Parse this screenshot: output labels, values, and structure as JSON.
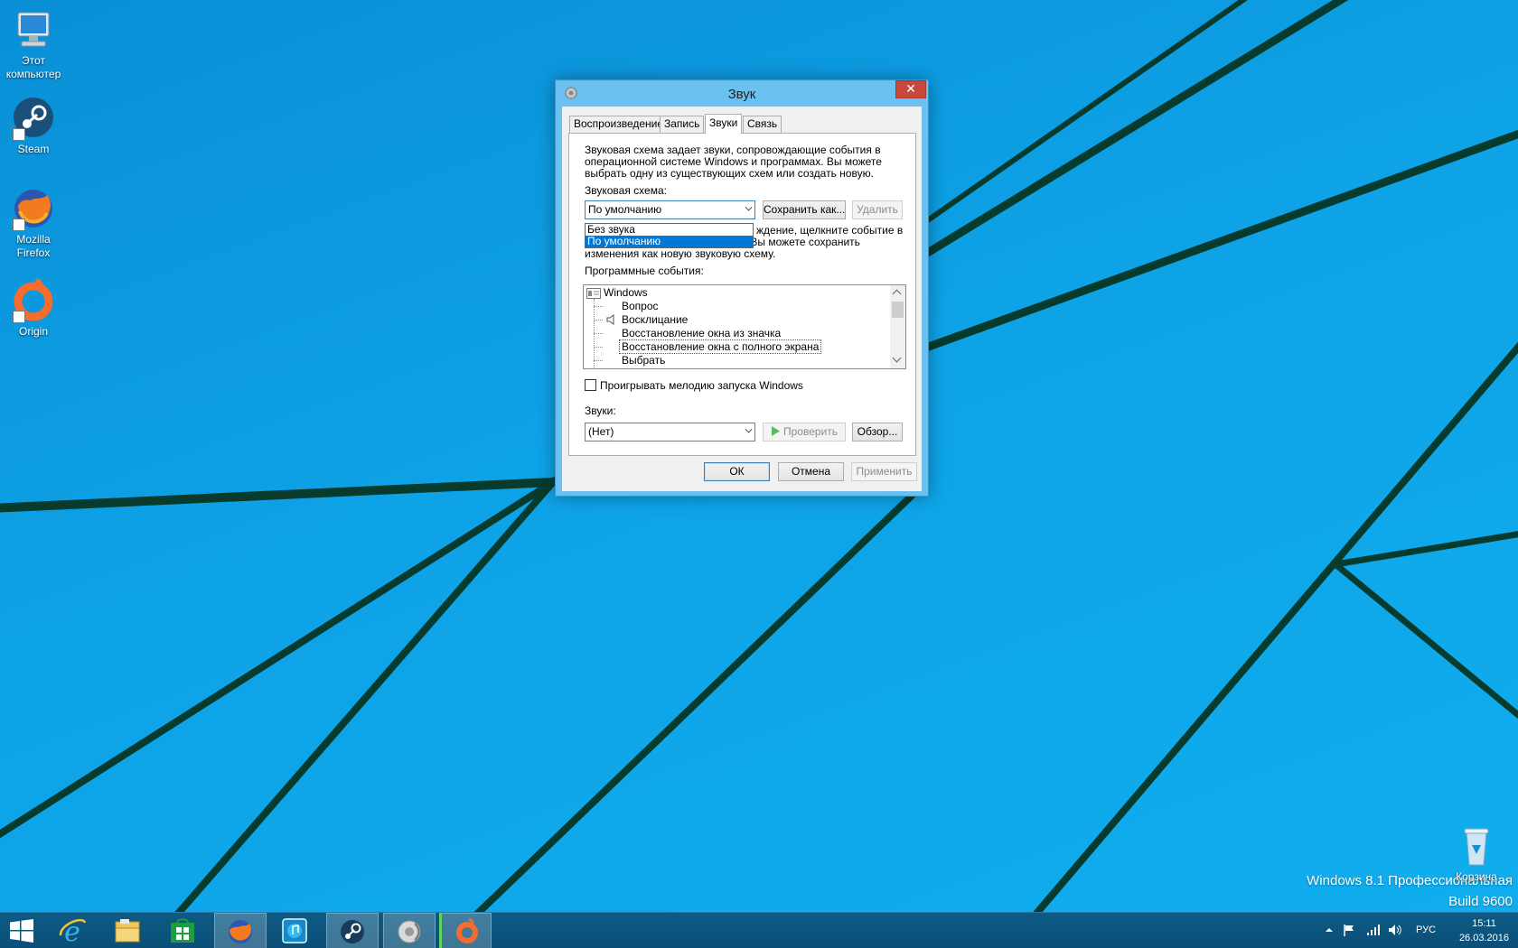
{
  "colors": {
    "desktop_blue": "#10aeee",
    "wallpaper_lines": "#063b2e",
    "dialog_frame": "#6ac1f1",
    "close_button": "#c7483b",
    "selection": "#0078d7",
    "taskbar": "#0b4f77"
  },
  "desktop_icons": [
    {
      "label": "Этот компьютер",
      "icon": "computer-icon"
    },
    {
      "label": "Steam",
      "icon": "steam-icon"
    },
    {
      "label": "Mozilla Firefox",
      "icon": "firefox-icon"
    },
    {
      "label": "Origin",
      "icon": "origin-icon"
    },
    {
      "label": "Корзина",
      "icon": "recycle-bin-icon"
    }
  ],
  "dialog": {
    "title": "Звук",
    "close_label": "✕",
    "tabs": [
      {
        "label": "Воспроизведение",
        "active": false
      },
      {
        "label": "Запись",
        "active": false
      },
      {
        "label": "Звуки",
        "active": true
      },
      {
        "label": "Связь",
        "active": false
      }
    ],
    "description_lines": [
      "Звуковая схема задает звуки, сопровождающие события в",
      "операционной системе Windows и программах. Вы можете",
      "выбрать одну из существующих схем или создать новую."
    ],
    "scheme_label": "Звуковая схема:",
    "scheme_value": "По умолчанию",
    "scheme_options": [
      {
        "label": "Без звука",
        "selected": false
      },
      {
        "label": "По умолчанию",
        "selected": true
      }
    ],
    "save_as_label": "Сохранить как...",
    "delete_label": "Удалить",
    "hint_lines": [
      "ждение, щелкните событие в",
      "списке и выберите нужный звук. Вы можете сохранить",
      "изменения как новую звуковую схему."
    ],
    "events_label": "Программные события:",
    "events": [
      {
        "label": "Windows",
        "level": 0,
        "has_sound": false
      },
      {
        "label": "Вопрос",
        "level": 1,
        "has_sound": false
      },
      {
        "label": "Восклицание",
        "level": 1,
        "has_sound": true
      },
      {
        "label": "Восстановление окна из значка",
        "level": 1,
        "has_sound": false
      },
      {
        "label": "Восстановление окна с полного экрана",
        "level": 1,
        "has_sound": false,
        "focused": true
      },
      {
        "label": "Выбрать",
        "level": 1,
        "has_sound": false
      }
    ],
    "startup_checkbox_label": "Проигрывать мелодию запуска Windows",
    "startup_checked": false,
    "sounds_label": "Звуки:",
    "sounds_value": "(Нет)",
    "test_label": "Проверить",
    "browse_label": "Обзор...",
    "ok_label": "ОК",
    "cancel_label": "Отмена",
    "apply_label": "Применить"
  },
  "watermark": {
    "line1": "Windows 8.1 Профессиональная",
    "line2": "Build 9600"
  },
  "taskbar": {
    "items": [
      {
        "icon": "ie-icon",
        "active": false
      },
      {
        "icon": "file-explorer-icon",
        "active": false
      },
      {
        "icon": "store-icon",
        "active": false
      },
      {
        "icon": "firefox-icon",
        "active": true
      },
      {
        "icon": "music-icon",
        "active": false
      },
      {
        "icon": "steam-icon",
        "active": true
      },
      {
        "icon": "sound-icon",
        "active": true
      },
      {
        "icon": "origin-icon",
        "active": true
      }
    ],
    "language": "РУС",
    "time": "15:11",
    "date": "26.03.2016"
  }
}
